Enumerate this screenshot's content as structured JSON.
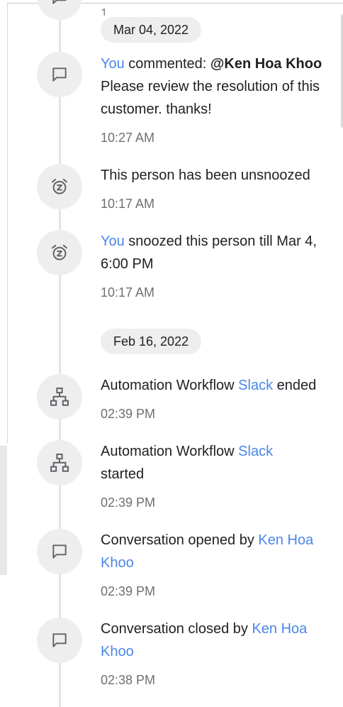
{
  "activity": {
    "top_partial_char": "1",
    "groups": [
      {
        "date": "Mar 04, 2022",
        "entries": [
          {
            "actor": "You",
            "verb": " commented: ",
            "mention": "@Ken Hoa Khoo",
            "message": " Please review the resolution of this customer. thanks!",
            "time": "10:27 AM",
            "icon": "comment-icon"
          },
          {
            "text": "This person has been unsnoozed",
            "time": "10:17 AM",
            "icon": "alarm-snooze-icon"
          },
          {
            "actor": "You",
            "text": " snoozed this person till Mar 4, 6:00 PM",
            "time": "10:17 AM",
            "icon": "alarm-snooze-icon"
          }
        ]
      },
      {
        "date": "Feb 16, 2022",
        "entries": [
          {
            "prefix": "Automation Workflow ",
            "link": "Slack",
            "suffix": " ended",
            "time": "02:39 PM",
            "icon": "workflow-icon"
          },
          {
            "prefix": "Automation Workflow ",
            "link": "Slack",
            "suffix": " started",
            "time": "02:39 PM",
            "icon": "workflow-icon"
          },
          {
            "prefix": "Conversation opened by ",
            "link": "Ken Hoa Khoo",
            "time": "02:39 PM",
            "icon": "comment-icon"
          },
          {
            "prefix": "Conversation closed by ",
            "link": "Ken Hoa Khoo",
            "time": "02:38 PM",
            "icon": "comment-icon"
          }
        ]
      }
    ]
  },
  "colors": {
    "link": "#4a86e8",
    "muted_text": "#6f6f6f",
    "icon_bg": "#eeeeee",
    "timeline": "#e3e3e3"
  }
}
